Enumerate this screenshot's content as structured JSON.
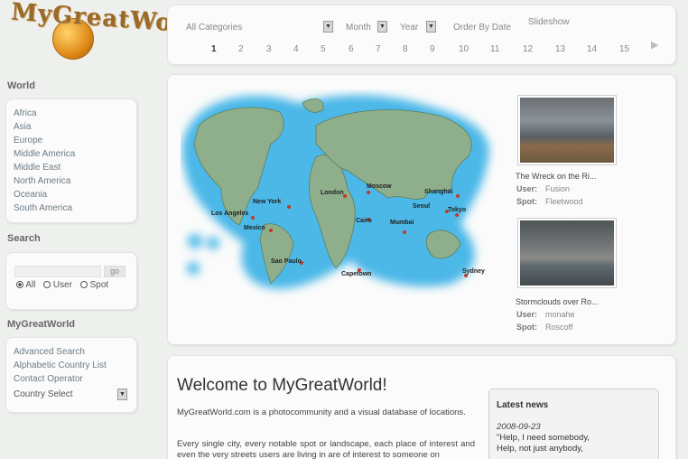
{
  "logo": {
    "text": "MyGreatWorld"
  },
  "sidebar": {
    "world_heading": "World",
    "regions": [
      "Africa",
      "Asia",
      "Europe",
      "Middle America",
      "Middle East",
      "North America",
      "Oceania",
      "South America"
    ],
    "search_heading": "Search",
    "search_input_value": "",
    "search_button": "go",
    "search_scope": {
      "all": "All",
      "user": "User",
      "spot": "Spot",
      "selected": "All"
    },
    "mgw_heading": "MyGreatWorld",
    "mgw_links": [
      "Advanced Search",
      "Alphabetic Country List",
      "Contact Operator"
    ],
    "country_select": "Country Select"
  },
  "filters": {
    "categories": "All Categories",
    "month": "Month",
    "year": "Year",
    "order": "Order By Date",
    "slideshow": "Slideshow"
  },
  "pagination": {
    "pages": [
      "1",
      "2",
      "3",
      "4",
      "5",
      "6",
      "7",
      "8",
      "9",
      "10",
      "11",
      "12",
      "13",
      "14",
      "15"
    ],
    "current": "1",
    "next_icon": "play-right-icon"
  },
  "map": {
    "cities": [
      "New York",
      "London",
      "Moscow",
      "Shanghai",
      "Seoul",
      "Tokyo",
      "Los Angeles",
      "Mexico",
      "Cairo",
      "Mumbai",
      "Sao Paulo",
      "Capetown",
      "Sydney"
    ]
  },
  "photos": [
    {
      "caption": "The Wreck on the Ri...",
      "user_label": "User:",
      "user": "Fusion",
      "spot_label": "Spot:",
      "spot": "Fleetwood"
    },
    {
      "caption": "Stormclouds over Ro...",
      "user_label": "User:",
      "user": "monahe",
      "spot_label": "Spot:",
      "spot": "Roscoff"
    }
  ],
  "welcome": {
    "title": "Welcome to MyGreatWorld!",
    "p1": "MyGreatWorld.com is a photocommunity and a visual database of locations.",
    "p2": "Every single city, every notable spot or landscape, each place of interest and even the very streets users are living in are of interest to someone on"
  },
  "news": {
    "title": "Latest news",
    "date": "2008-09-23",
    "lines": [
      "\"Help, I need somebody,",
      "Help, not just anybody,"
    ]
  },
  "colors": {
    "ocean": "#4bb8e8",
    "land": "#8fae8c",
    "marker": "#c0392b"
  }
}
